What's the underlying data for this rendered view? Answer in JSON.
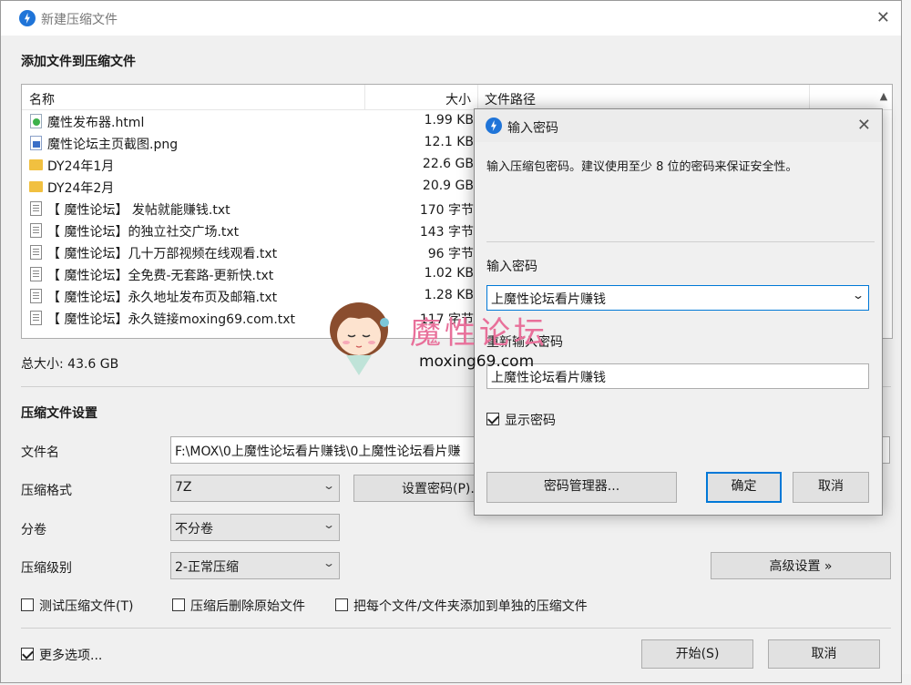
{
  "window": {
    "title": "新建压缩文件"
  },
  "files_section": {
    "title": "添加文件到压缩文件",
    "columns": {
      "name": "名称",
      "size": "大小",
      "path": "文件路径"
    },
    "files": [
      {
        "name": "魔性发布器.html",
        "size": "1.99 KB",
        "icon": "html-file-icon"
      },
      {
        "name": "魔性论坛主页截图.png",
        "size": "12.1 KB",
        "icon": "image-file-icon"
      },
      {
        "name": "DY24年1月",
        "size": "22.6 GB",
        "icon": "folder-icon"
      },
      {
        "name": "DY24年2月",
        "size": "20.9 GB",
        "icon": "folder-icon"
      },
      {
        "name": "【 魔性论坛】 发帖就能赚钱.txt",
        "size": "170 字节",
        "icon": "text-file-icon"
      },
      {
        "name": "【 魔性论坛】的独立社交广场.txt",
        "size": "143 字节",
        "icon": "text-file-icon"
      },
      {
        "name": "【 魔性论坛】几十万部视频在线观看.txt",
        "size": "96 字节",
        "icon": "text-file-icon"
      },
      {
        "name": "【 魔性论坛】全免费-无套路-更新快.txt",
        "size": "1.02 KB",
        "icon": "text-file-icon"
      },
      {
        "name": "【 魔性论坛】永久地址发布页及邮箱.txt",
        "size": "1.28 KB",
        "icon": "text-file-icon"
      },
      {
        "name": "【 魔性论坛】永久链接moxing69.com.txt",
        "size": "117 字节",
        "icon": "text-file-icon"
      }
    ],
    "total": "总大小: 43.6 GB"
  },
  "settings": {
    "title": "压缩文件设置",
    "filename_label": "文件名",
    "filename_value": "F:\\MOX\\0上魔性论坛看片赚钱\\0上魔性论坛看片赚",
    "format_label": "压缩格式",
    "format_value": "7Z",
    "set_password_button": "设置密码(P)...",
    "split_label": "分卷",
    "split_value": "不分卷",
    "level_label": "压缩级别",
    "level_value": "2-正常压缩",
    "advanced_button": "高级设置 »",
    "test_checkbox": "测试压缩文件(T)",
    "delete_checkbox": "压缩后删除原始文件",
    "separate_checkbox": "把每个文件/文件夹添加到单独的压缩文件",
    "more_options": "更多选项...",
    "start_button": "开始(S)",
    "cancel_button": "取消"
  },
  "password_dialog": {
    "title": "输入密码",
    "description": "输入压缩包密码。建议使用至少 8 位的密码来保证安全性。",
    "password_label": "输入密码",
    "password_value": "上魔性论坛看片赚钱",
    "confirm_label": "重新输入密码",
    "confirm_value": "上魔性论坛看片赚钱",
    "show_password": "显示密码",
    "manager_button": "密码管理器...",
    "ok_button": "确定",
    "cancel_button": "取消"
  },
  "watermark": {
    "title": "魔性论坛",
    "url": "moxing69.com"
  },
  "colors": {
    "accent": "#0078d7",
    "app_icon": "#1f74d8",
    "watermark": "#e8709a"
  }
}
